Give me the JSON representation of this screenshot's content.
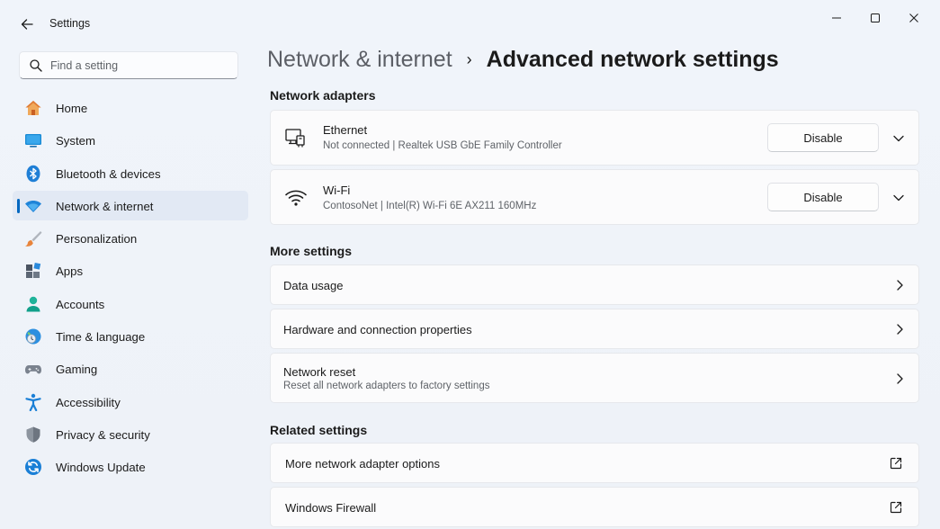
{
  "window": {
    "title": "Settings",
    "controls": [
      "minimize",
      "maximize",
      "close"
    ]
  },
  "search": {
    "placeholder": "Find a setting",
    "value": ""
  },
  "sidebar": {
    "items": [
      {
        "label": "Home",
        "icon": "home-icon",
        "active": false
      },
      {
        "label": "System",
        "icon": "system-icon",
        "active": false
      },
      {
        "label": "Bluetooth & devices",
        "icon": "bluetooth-icon",
        "active": false
      },
      {
        "label": "Network & internet",
        "icon": "network-icon",
        "active": true
      },
      {
        "label": "Personalization",
        "icon": "brush-icon",
        "active": false
      },
      {
        "label": "Apps",
        "icon": "apps-icon",
        "active": false
      },
      {
        "label": "Accounts",
        "icon": "accounts-icon",
        "active": false
      },
      {
        "label": "Time & language",
        "icon": "globe-clock-icon",
        "active": false
      },
      {
        "label": "Gaming",
        "icon": "gamepad-icon",
        "active": false
      },
      {
        "label": "Accessibility",
        "icon": "accessibility-icon",
        "active": false
      },
      {
        "label": "Privacy & security",
        "icon": "shield-icon",
        "active": false
      },
      {
        "label": "Windows Update",
        "icon": "update-icon",
        "active": false
      }
    ]
  },
  "header": {
    "parent": "Network & internet",
    "separator": "›",
    "current": "Advanced network settings"
  },
  "network_adapters": {
    "title": "Network adapters",
    "items": [
      {
        "name": "Ethernet",
        "detail": "Not connected  |  Realtek USB GbE Family Controller",
        "button": "Disable",
        "icon": "ethernet-icon"
      },
      {
        "name": "Wi-Fi",
        "detail": "ContosoNet  |  Intel(R) Wi-Fi 6E AX211 160MHz",
        "button": "Disable",
        "icon": "wifi-icon"
      }
    ]
  },
  "more_settings": {
    "title": "More settings",
    "items": [
      {
        "label": "Data usage",
        "sub": ""
      },
      {
        "label": "Hardware and connection properties",
        "sub": ""
      },
      {
        "label": "Network reset",
        "sub": "Reset all network adapters to factory settings"
      }
    ]
  },
  "related_settings": {
    "title": "Related settings",
    "items": [
      {
        "label": "More network adapter options"
      },
      {
        "label": "Windows Firewall"
      }
    ]
  },
  "colors": {
    "accent": "#0067c0",
    "background": "#eef2f9",
    "card": "#fbfbfc"
  }
}
